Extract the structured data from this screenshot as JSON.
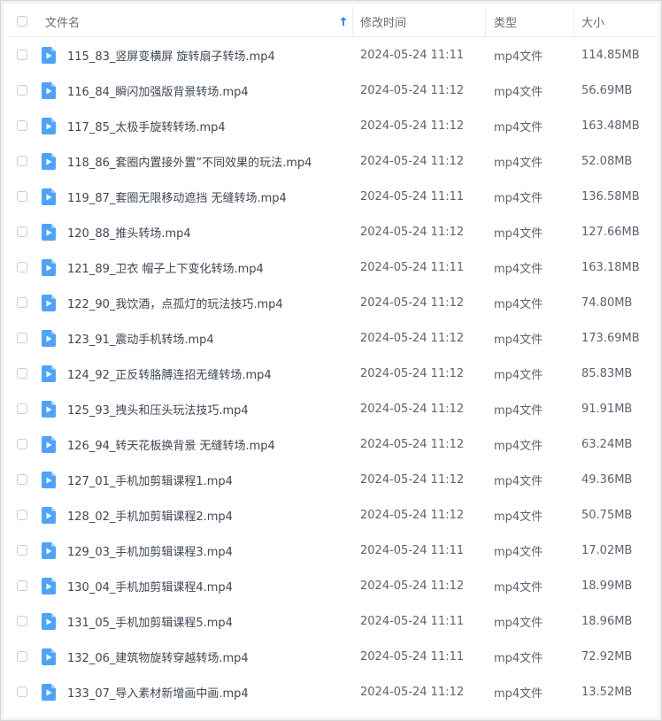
{
  "header": {
    "name": "文件名",
    "time": "修改时间",
    "type": "类型",
    "size": "大小"
  },
  "colors": {
    "accent": "#2d8cf0",
    "icon_blue": "#4fa3f7"
  },
  "rows": [
    {
      "name": "115_83_竖屏变横屏 旋转扇子转场.mp4",
      "time": "2024-05-24 11:11",
      "type": "mp4文件",
      "size": "114.85MB"
    },
    {
      "name": "116_84_瞬闪加强版背景转场.mp4",
      "time": "2024-05-24 11:12",
      "type": "mp4文件",
      "size": "56.69MB"
    },
    {
      "name": "117_85_太极手旋转转场.mp4",
      "time": "2024-05-24 11:12",
      "type": "mp4文件",
      "size": "163.48MB"
    },
    {
      "name": "118_86_套圈内置接外置”不同效果的玩法.mp4",
      "time": "2024-05-24 11:12",
      "type": "mp4文件",
      "size": "52.08MB"
    },
    {
      "name": "119_87_套圈无限移动遮挡 无缝转场.mp4",
      "time": "2024-05-24 11:11",
      "type": "mp4文件",
      "size": "136.58MB"
    },
    {
      "name": "120_88_推头转场.mp4",
      "time": "2024-05-24 11:12",
      "type": "mp4文件",
      "size": "127.66MB"
    },
    {
      "name": "121_89_卫衣 帽子上下变化转场.mp4",
      "time": "2024-05-24 11:11",
      "type": "mp4文件",
      "size": "163.18MB"
    },
    {
      "name": "122_90_我饮酒，点孤灯的玩法技巧.mp4",
      "time": "2024-05-24 11:12",
      "type": "mp4文件",
      "size": "74.80MB"
    },
    {
      "name": "123_91_震动手机转场.mp4",
      "time": "2024-05-24 11:12",
      "type": "mp4文件",
      "size": "173.69MB"
    },
    {
      "name": "124_92_正反转胳膊连招无缝转场.mp4",
      "time": "2024-05-24 11:12",
      "type": "mp4文件",
      "size": "85.83MB"
    },
    {
      "name": "125_93_拽头和压头玩法技巧.mp4",
      "time": "2024-05-24 11:12",
      "type": "mp4文件",
      "size": "91.91MB"
    },
    {
      "name": "126_94_转天花板换背景 无缝转场.mp4",
      "time": "2024-05-24 11:12",
      "type": "mp4文件",
      "size": "63.24MB"
    },
    {
      "name": "127_01_手机加剪辑课程1.mp4",
      "time": "2024-05-24 11:12",
      "type": "mp4文件",
      "size": "49.36MB"
    },
    {
      "name": "128_02_手机加剪辑课程2.mp4",
      "time": "2024-05-24 11:12",
      "type": "mp4文件",
      "size": "50.75MB"
    },
    {
      "name": "129_03_手机加剪辑课程3.mp4",
      "time": "2024-05-24 11:11",
      "type": "mp4文件",
      "size": "17.02MB"
    },
    {
      "name": "130_04_手机加剪辑课程4.mp4",
      "time": "2024-05-24 11:12",
      "type": "mp4文件",
      "size": "18.99MB"
    },
    {
      "name": "131_05_手机加剪辑课程5.mp4",
      "time": "2024-05-24 11:11",
      "type": "mp4文件",
      "size": "18.96MB"
    },
    {
      "name": "132_06_建筑物旋转穿越转场.mp4",
      "time": "2024-05-24 11:11",
      "type": "mp4文件",
      "size": "72.92MB"
    },
    {
      "name": "133_07_导入素材新增画中画.mp4",
      "time": "2024-05-24 11:12",
      "type": "mp4文件",
      "size": "13.52MB"
    }
  ]
}
